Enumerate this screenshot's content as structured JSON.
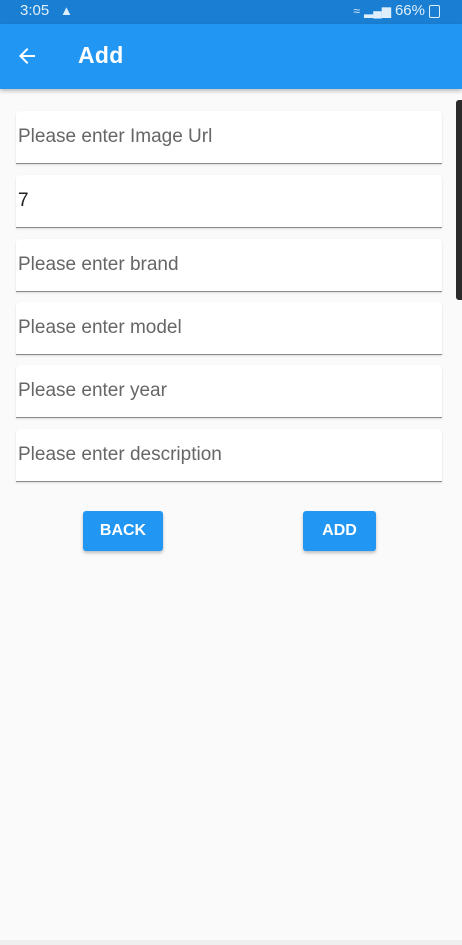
{
  "status_bar": {
    "time": "3:05",
    "notify_icon": "notification-icon",
    "battery_percent": "66%",
    "color": "#1a7fd2"
  },
  "app_bar": {
    "title": "Add",
    "back_icon": "back-arrow-icon",
    "color": "#2196f3"
  },
  "form": {
    "image_url": {
      "value": "",
      "placeholder": "Please enter Image Url"
    },
    "id": {
      "value": "7",
      "placeholder": ""
    },
    "brand": {
      "value": "",
      "placeholder": "Please enter brand"
    },
    "model": {
      "value": "",
      "placeholder": "Please enter model"
    },
    "year": {
      "value": "",
      "placeholder": "Please enter year"
    },
    "description": {
      "value": "",
      "placeholder": "Please enter description"
    }
  },
  "buttons": {
    "back_label": "BACK",
    "add_label": "ADD"
  }
}
